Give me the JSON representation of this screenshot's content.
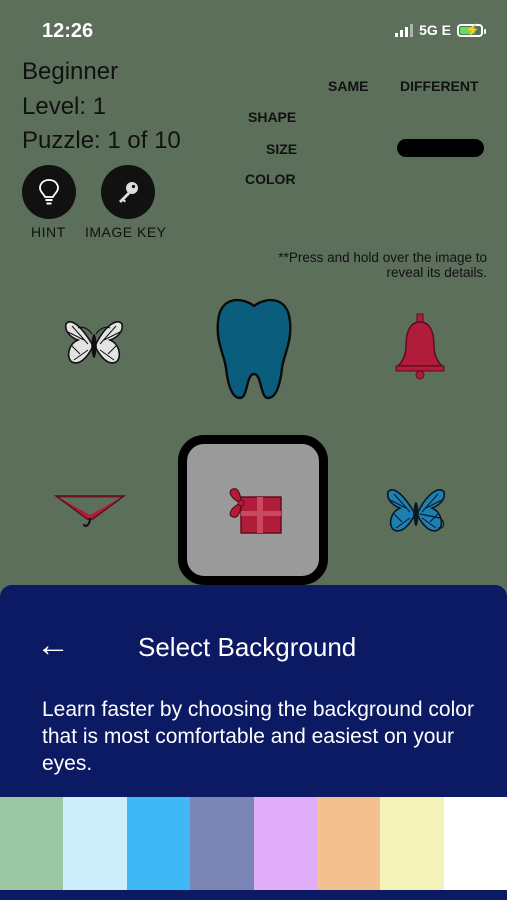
{
  "status_bar": {
    "time": "12:26",
    "network": "5G E"
  },
  "info": {
    "mode": "Beginner",
    "level": "Level: 1",
    "puzzle": "Puzzle: 1 of 10"
  },
  "comparison": {
    "columns": [
      "SAME",
      "DIFFERENT"
    ],
    "rows": [
      "SHAPE",
      "SIZE",
      "COLOR"
    ]
  },
  "buttons": {
    "hint": "HINT",
    "image_key": "IMAGE KEY"
  },
  "note": "**Press and hold over the image to\nreveal its details.",
  "images": [
    "butterfly-outline",
    "tooth",
    "bell",
    "hanger",
    "gift",
    "butterfly-blue"
  ],
  "sheet": {
    "title": "Select Background",
    "description": "Learn faster by choosing the background color that is most comfortable and easiest on your eyes.",
    "swatches": [
      "#9cc7a4",
      "#cdeffc",
      "#3fb8f5",
      "#7b85b5",
      "#e0aef9",
      "#f3c08e",
      "#f4f2b8",
      "#ffffff"
    ]
  },
  "colors": {
    "background": "#5b6f5b",
    "sheet": "#0c1a64",
    "tooth": "#0b5d7e",
    "bell": "#b01c3a"
  }
}
